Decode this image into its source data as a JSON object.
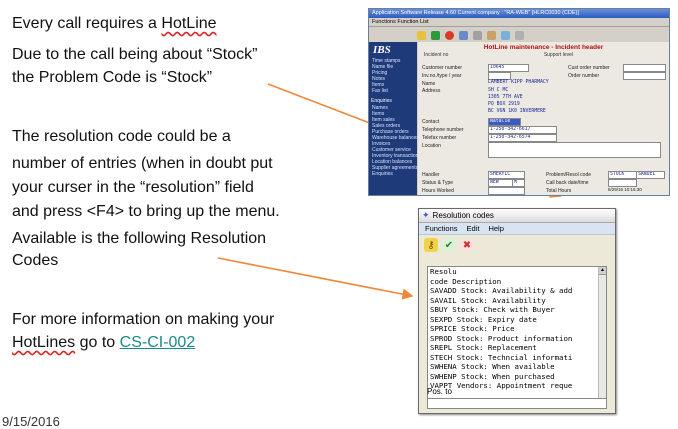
{
  "slide": {
    "line1_pre": "Every call requires a ",
    "line1_word": "HotLine",
    "line2": "Due to the call being about “Stock”",
    "line3": "the Problem Code is “Stock”",
    "para1": [
      "The resolution code could be a",
      "number of entries (when in doubt put",
      "your curser in the “resolution” field",
      "and press <F4> to bring up the menu."
    ],
    "para2": [
      "Available is the following Resolution",
      "Codes"
    ],
    "para3_line1": "For more information on making your",
    "para3_word": "HotLines",
    "para3_mid": " go to ",
    "para3_link": "CS-CI-002",
    "date": "9/15/2016"
  },
  "app": {
    "title": "Application Software Release 4.60 Current company : \"RA-WEB\" [HLRC0030 (CDE)]",
    "menu": "Functions   Function List",
    "logo": "IBS",
    "nav_top": [
      "Time stamps",
      "Name file",
      "Pricing",
      "Notes",
      "Items",
      "Fax list"
    ],
    "nav_enquiries_head": "Enquiries",
    "nav_enquiries": [
      "Names",
      "Items",
      "Item sales",
      "Sales orders",
      "Purchase orders",
      "Warehouse balances",
      "Invoices",
      "Customer service",
      "Inventory transactions",
      "Location balances",
      "Supplier agreements",
      "Enquiries"
    ],
    "header_title": "HotLine maintenance - Incident header",
    "incident_label": "Incident no",
    "support_label": "Support level",
    "fields": {
      "customer_label": "Customer number",
      "customer_value": "10645",
      "custorder_label": "Cust order number",
      "invno_label": "Inv.no./type / year",
      "ordernum_label": "Order number",
      "name_label": "Name",
      "name_value": "LAMBERT KIPP PHARMACY",
      "address_label": "Address",
      "address_lines": [
        "SH C MC",
        "1305 7TH AVE",
        "PO BOX 2919",
        "BC V6N 1K0       INVERMERE"
      ],
      "contact_label": "Contact",
      "contact_value": "Natalie",
      "phone_label": "Telephone number",
      "phone_value": "1-250-342-6617",
      "telefax_label": "Telefax number",
      "telefax_value": "1-250-342-6574",
      "location_label": "Location",
      "handler_label": "Handler",
      "handler_value": "SHERYLC",
      "status_label": "Status & Type",
      "status_value": "NEW",
      "status_type": "M",
      "hours_label": "Hours Worked",
      "problem_label": "Problem/Resol code",
      "problem_value": "STOCK",
      "resol_value": "SANUEL",
      "callback_label": "Call back date/time",
      "total_label": "Total Hours",
      "status_date": "8/29/16",
      "status_time": "10:16:30"
    }
  },
  "resolution": {
    "title": "Resolution codes",
    "menu": [
      "Functions",
      "Edit",
      "Help"
    ],
    "head1": "Resolu",
    "head2": "code  Description",
    "rows": [
      "SAVADD Stock: Availability & add",
      "SAVAIL Stock: Availability",
      "SBUY   Stock: Check with Buyer",
      "SEXPD  Stock: Expiry date",
      "SPRICE Stock: Price",
      "SPROD  Stock: Product information",
      "SREPL  Stock: Replacement",
      "STECH  Stock: Techncial informati",
      "SWHENA Stock: When available",
      "SWHENP Stock: When purchased",
      "VAPPT  Vendors: Appointment reque"
    ],
    "posto_label": "Pos. to"
  },
  "colors": {
    "arrow": "#f0883a",
    "link": "#1a8a8a",
    "title_red": "#b01010",
    "nav_bg": "#1e3a78"
  }
}
